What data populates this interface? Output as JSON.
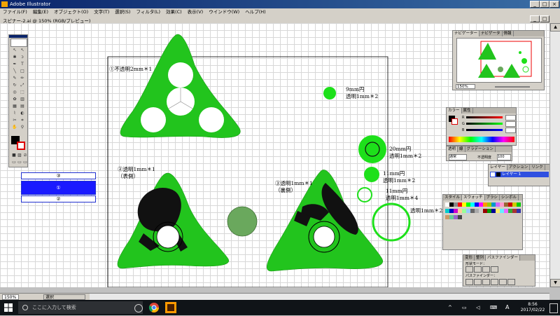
{
  "window": {
    "title": "Adobe Illustrator"
  },
  "menu": [
    "ファイル(F)",
    "編集(E)",
    "オブジェクト(O)",
    "文字(T)",
    "選択(S)",
    "フィルタ(L)",
    "効果(C)",
    "表示(V)",
    "ウインドウ(W)",
    "ヘルプ(H)"
  ],
  "document": {
    "title": "スピナー-2.ai @ 150% (RGB/プレビュー)"
  },
  "labels": {
    "l1": "①不透明2mm＊1",
    "l2a": "②透明1mm＊1",
    "l2b": "（表側）",
    "l3a": "③透明1mm＊1",
    "l3b": "（裏側）",
    "c1a": "9mm円",
    "c1b": "透明1mm＊2",
    "c2a": "20mm円",
    "c2b": "透明1mm＊2",
    "c3a": "11mm円",
    "c3b": "透明1mm＊2",
    "c4a": "11mm円",
    "c4b": "透明1mm＊4",
    "c5": "透明1mm＊2"
  },
  "layer_stack": {
    "top": "③",
    "middle": "①",
    "bottom": "②"
  },
  "navigator": {
    "tabs": [
      "ナビゲーター",
      "ナビゲータ",
      "情報"
    ],
    "zoom": "150%"
  },
  "color_panel": {
    "tabs": [
      "カラー",
      "属性"
    ],
    "channels": [
      "R",
      "G",
      "B"
    ]
  },
  "transparency_panel": {
    "tabs": [
      "透明",
      "線",
      "グラデーション"
    ],
    "mode": "通常",
    "opacity_label": "不透明度",
    "opacity": "100"
  },
  "layers_panel": {
    "tabs": [
      "レイヤー",
      "アクション",
      "リンク"
    ],
    "layer_name": "レイヤー 1"
  },
  "swatches_panel": {
    "tabs": [
      "スタイル",
      "スウォッチ",
      "ブラシ",
      "シンボル"
    ]
  },
  "pathfinder_panel": {
    "tabs": [
      "変形",
      "整列",
      "パスファインダー"
    ],
    "shape_label": "形状モード：",
    "pathfinder_label": "パスファインダー："
  },
  "statusbar": {
    "zoom": "150%",
    "status": "選択"
  },
  "taskbar": {
    "search_placeholder": "ここに入力して検索",
    "time": "8:56",
    "date": "2017/02/22"
  },
  "colors": {
    "shape_green": "#22c41d",
    "gray_circle": "#6aa85d",
    "title_blue": "#0a246a",
    "layer_blue": "#1a1aff"
  },
  "icons": [
    "windows-start-icon",
    "search-icon",
    "chrome-icon",
    "folder-icon",
    "illustrator-icon"
  ]
}
